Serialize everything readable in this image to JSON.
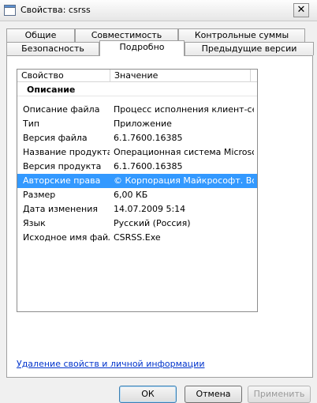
{
  "window": {
    "title": "Свойства: csrss",
    "close_symbol": "✕"
  },
  "tabs": {
    "row1": [
      "Общие",
      "Совместимость",
      "Контрольные суммы"
    ],
    "row2": [
      "Безопасность",
      "Подробно",
      "Предыдущие версии"
    ],
    "active": "Подробно"
  },
  "list": {
    "headers": {
      "property": "Свойство",
      "value": "Значение"
    },
    "group_label": "Описание",
    "rows": [
      {
        "property": "Описание файла",
        "value": "Процесс исполнения клиент-се..."
      },
      {
        "property": "Тип",
        "value": "Приложение"
      },
      {
        "property": "Версия файла",
        "value": "6.1.7600.16385"
      },
      {
        "property": "Название продукта",
        "value": "Операционная система Microso..."
      },
      {
        "property": "Версия продукта",
        "value": "6.1.7600.16385"
      },
      {
        "property": "Авторские права",
        "value": "© Корпорация Майкрософт. Вс...",
        "selected": true
      },
      {
        "property": "Размер",
        "value": "6,00 КБ"
      },
      {
        "property": "Дата изменения",
        "value": "14.07.2009 5:14"
      },
      {
        "property": "Язык",
        "value": "Русский (Россия)"
      },
      {
        "property": "Исходное имя файла",
        "value": "CSRSS.Exe"
      }
    ]
  },
  "remove_link": "Удаление свойств и личной информации",
  "buttons": {
    "ok": "ОК",
    "cancel": "Отмена",
    "apply": "Применить"
  },
  "colors": {
    "selection": "#3399ff",
    "link": "#0033cc"
  },
  "icons": {
    "app": "window-app-icon",
    "close": "close-icon"
  }
}
